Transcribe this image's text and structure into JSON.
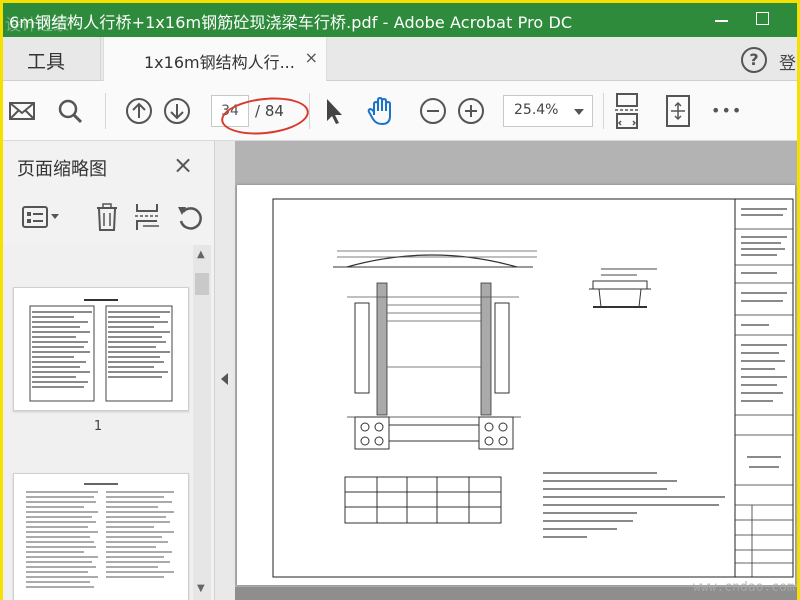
{
  "window": {
    "title": "6m钢结构人行桥+1x16m钢筋砼现浇梁车行桥.pdf - Adobe Acrobat Pro DC",
    "watermark_top_left": "设计之家"
  },
  "tabs": {
    "tools_label": "工具",
    "doc_label": "1x16m钢结构人行...",
    "doc_close": "×",
    "help": "?",
    "login": "登"
  },
  "toolbar": {
    "page_current": "34",
    "page_total": "/ 84",
    "zoom_value": "25.4%",
    "more": "•••"
  },
  "sidebar": {
    "title": "页面缩略图",
    "close": "×",
    "thumbnails": [
      {
        "label": "1"
      }
    ]
  },
  "watermark": "www.cndao.com",
  "colors": {
    "titlebar": "#2e8b3c",
    "annotation": "#d93a2b",
    "hand_tool": "#1a73c8"
  }
}
